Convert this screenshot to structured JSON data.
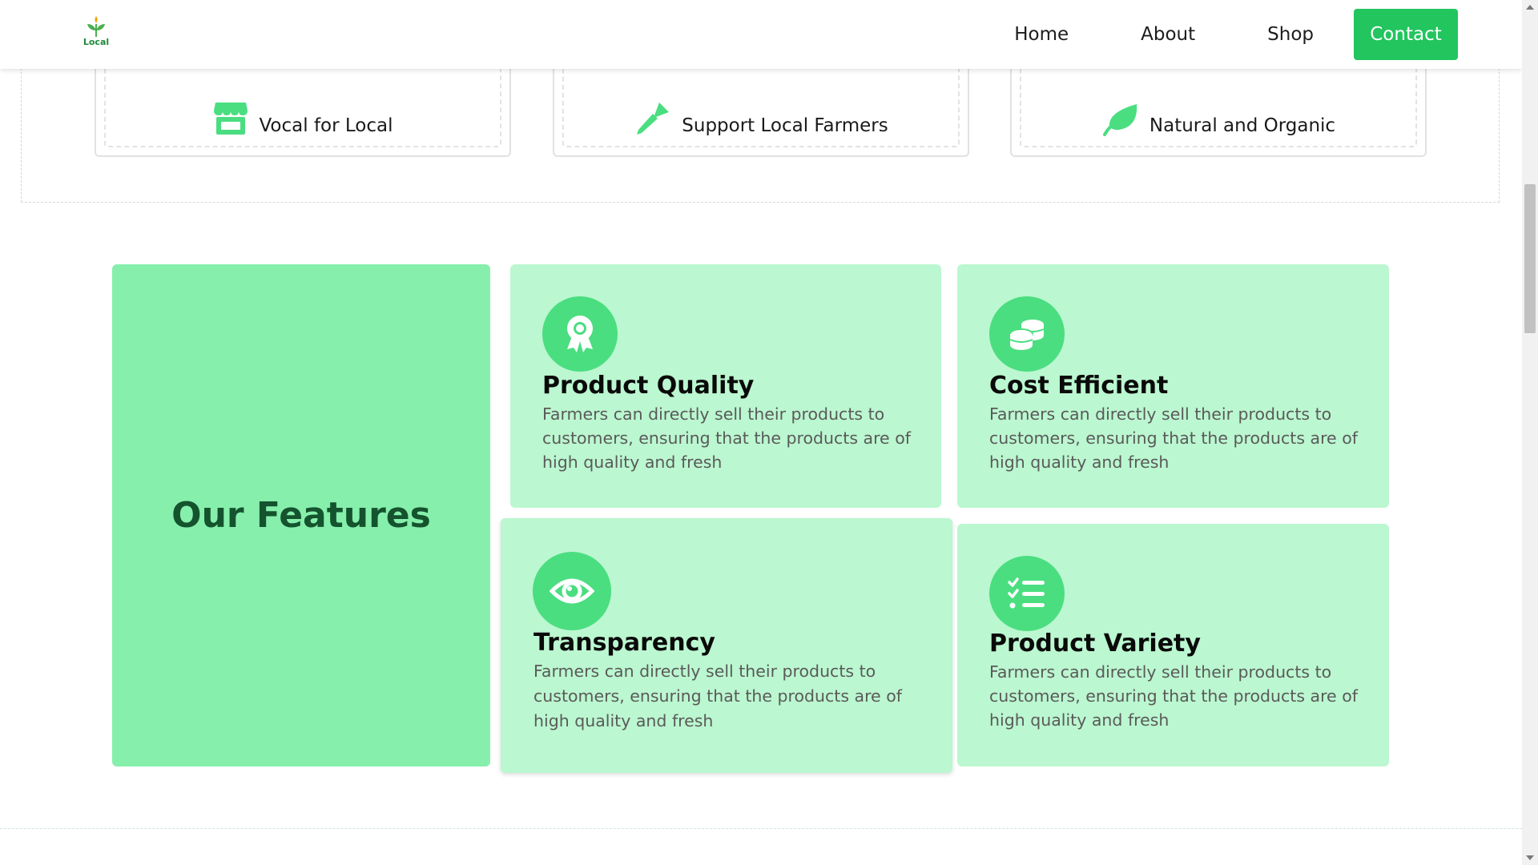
{
  "nav": {
    "logo_text": "Local",
    "links": [
      "Home",
      "About",
      "Shop"
    ],
    "contact": "Contact"
  },
  "badges": [
    {
      "label": "Vocal for Local",
      "icon": "store-icon"
    },
    {
      "label": "Support Local Farmers",
      "icon": "trowel-icon"
    },
    {
      "label": "Natural and Organic",
      "icon": "leaf-icon"
    }
  ],
  "features": {
    "heading": "Our Features",
    "items": [
      {
        "title": "Product Quality",
        "icon": "award-icon",
        "description": "Farmers can directly sell their products to customers, ensuring that the products are of high quality and fresh"
      },
      {
        "title": "Cost Efficient",
        "icon": "coins-icon",
        "description": "Farmers can directly sell their products to customers, ensuring that the products are of high quality and fresh"
      },
      {
        "title": "Transparency",
        "icon": "eye-icon",
        "description": "Farmers can directly sell their products to customers, ensuring that the products are of high quality and fresh"
      },
      {
        "title": "Product Variety",
        "icon": "list-check-icon",
        "description": "Farmers can directly sell their products to customers, ensuring that the products are of high quality and fresh"
      }
    ]
  },
  "colors": {
    "accent": "#22c55e",
    "title_card": "#86efac",
    "feature_card": "#bbf7d0",
    "icon_circle": "#4ade80",
    "heading_text": "#14532d"
  }
}
